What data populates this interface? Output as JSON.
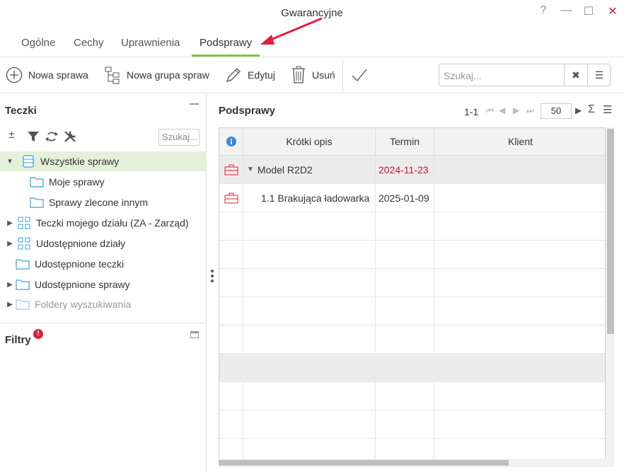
{
  "window": {
    "title": "Gwarancyjne",
    "help": "?",
    "minimize": "—",
    "maximize": "☐",
    "close": "✕"
  },
  "tabs": [
    {
      "label": "Ogólne"
    },
    {
      "label": "Cechy"
    },
    {
      "label": "Uprawnienia"
    },
    {
      "label": "Podsprawy",
      "active": true
    }
  ],
  "toolbar": {
    "new_case": "Nowa sprawa",
    "new_group": "Nowa grupa spraw",
    "edit": "Edytuj",
    "delete": "Usuń",
    "search_placeholder": "Szukaj..."
  },
  "left_panel": {
    "title": "Teczki",
    "search_placeholder": "Szukaj...",
    "tree": [
      {
        "label": "Wszystkie sprawy",
        "selected": true,
        "expanded": true
      },
      {
        "label": "Moje sprawy"
      },
      {
        "label": "Sprawy zlecone innym"
      },
      {
        "label": "Teczki mojego działu (ZA - Zarząd)"
      },
      {
        "label": "Udostępnione działy"
      },
      {
        "label": "Udostępnione teczki"
      },
      {
        "label": "Udostępnione sprawy"
      },
      {
        "label": "Foldery wyszukiwania",
        "disabled": true
      }
    ],
    "filters_title": "Filtry",
    "filters_badge": "!"
  },
  "right_panel": {
    "title": "Podsprawy",
    "pager": {
      "range": "1-1",
      "page_size": "50"
    },
    "columns": [
      "Krótki opis",
      "Termin",
      "Klient"
    ],
    "rows": [
      {
        "opis": "Model R2D2",
        "termin": "2024-11-23",
        "klient": "",
        "group": true,
        "overdue": true
      },
      {
        "opis": "1.1 Brakująca ładowarka",
        "termin": "2025-01-09",
        "klient": ""
      }
    ]
  },
  "colors": {
    "accent_green": "#7cc44a",
    "selected_bg": "#e4f1d8",
    "overdue_red": "#c8102e",
    "icon_blue": "#3aa0d8",
    "arrow_red": "#e0203a"
  }
}
